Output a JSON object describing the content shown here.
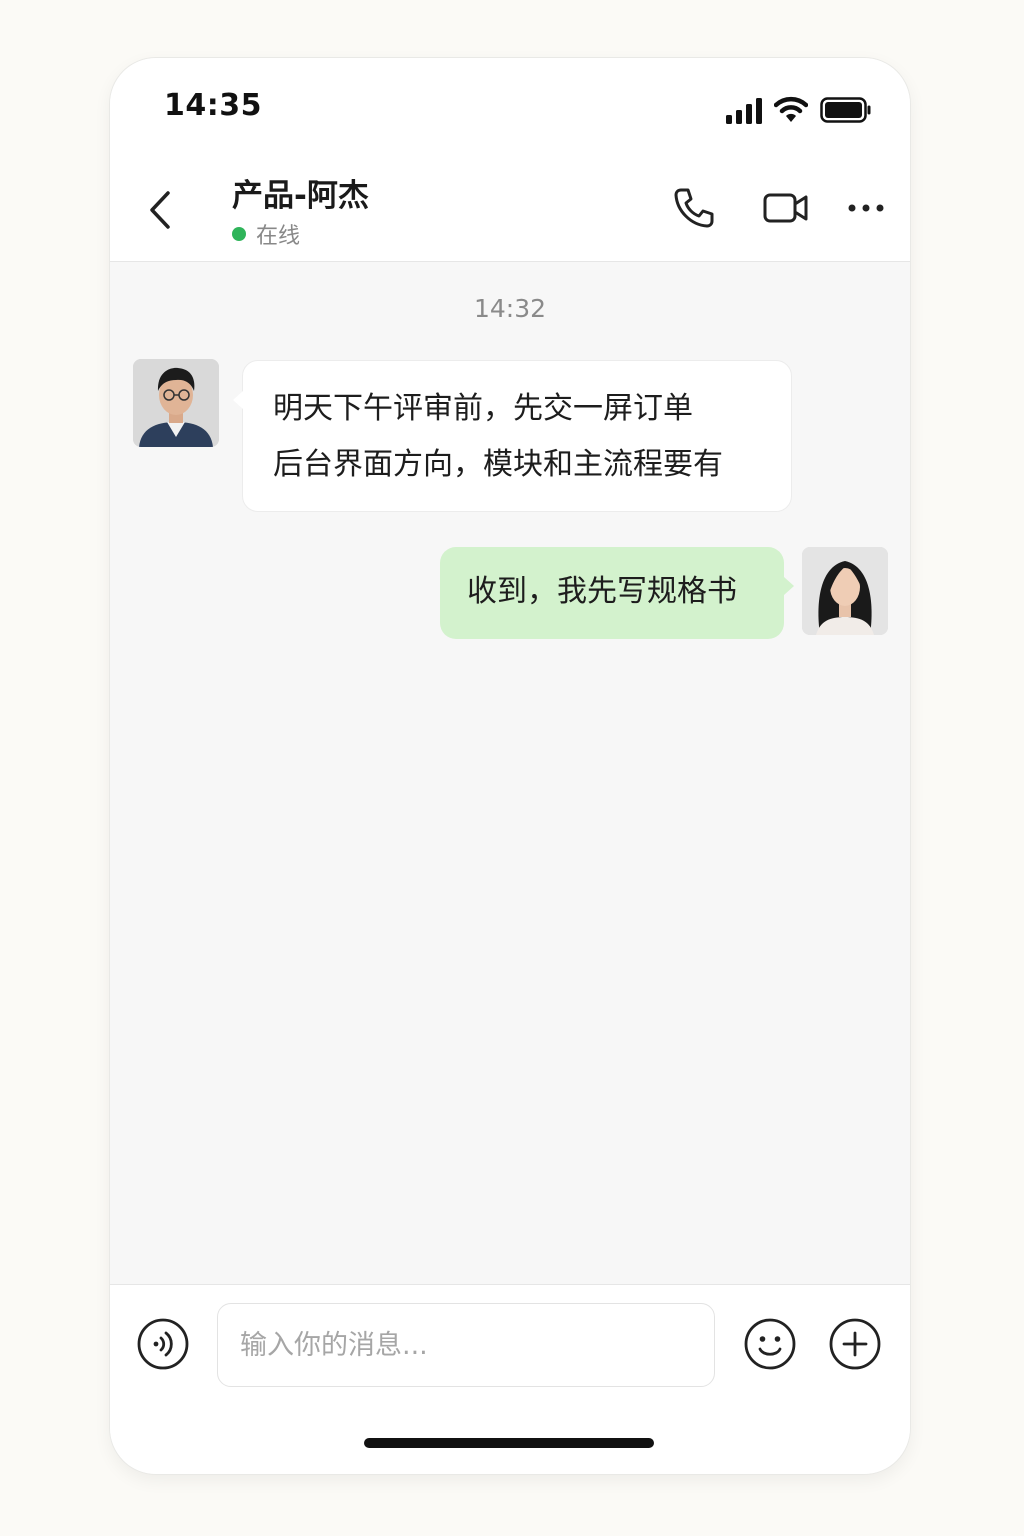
{
  "status_bar": {
    "time": "14:35",
    "icons": [
      "signal-icon",
      "wifi-icon",
      "battery-icon"
    ]
  },
  "header": {
    "contact_name": "产品-阿杰",
    "status": "在线",
    "status_color": "#2fb45a",
    "actions": [
      "back-icon",
      "phone-icon",
      "video-call-icon",
      "more-icon"
    ]
  },
  "chat": {
    "timestamp": "14:32",
    "messages": [
      {
        "direction": "incoming",
        "lines": [
          "明天下午评审前，先交一屏订单",
          "后台界面方向，模块和主流程要有"
        ]
      },
      {
        "direction": "outgoing",
        "text": "收到，我先写规格书"
      }
    ],
    "incoming_bubble_color": "#ffffff",
    "outgoing_bubble_color": "#d3f2cd"
  },
  "composer": {
    "placeholder": "输入你的消息...",
    "value": "",
    "buttons": [
      "voice-icon",
      "emoji-icon",
      "plus-icon"
    ]
  }
}
